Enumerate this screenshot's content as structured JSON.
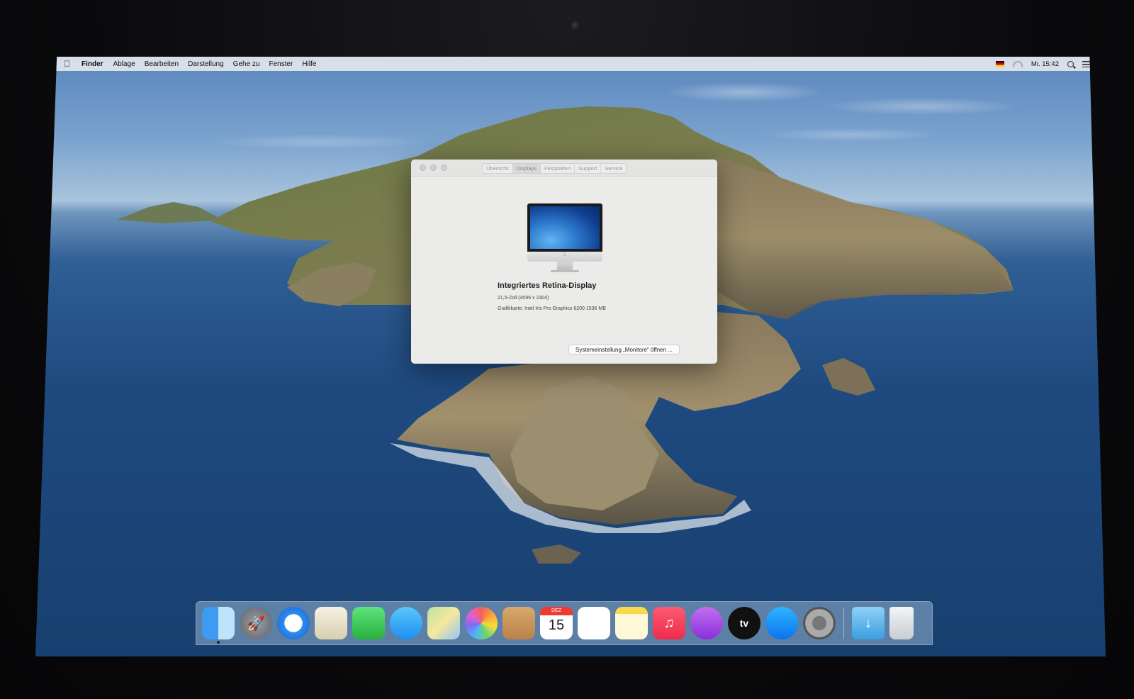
{
  "menubar": {
    "app": "Finder",
    "items": [
      "Ablage",
      "Bearbeiten",
      "Darstellung",
      "Gehe zu",
      "Fenster",
      "Hilfe"
    ],
    "clock": "Mi. 15:42"
  },
  "window": {
    "tabs": [
      "Übersicht",
      "Displays",
      "Festplatten",
      "Support",
      "Service"
    ],
    "active_tab": "Displays",
    "display_name": "Integriertes Retina-Display",
    "display_size": "21,5-Zoll (4096 x 2304)",
    "graphics": "Grafikkarte: Intel Iris Pro Graphics 6200 1536 MB",
    "open_button": "Systemeinstellung „Monitore“ öffnen ..."
  },
  "dock": {
    "calendar_month": "DEZ",
    "calendar_day": "15",
    "tv_label": "tv"
  },
  "colors": {
    "accent": "#2d8df2",
    "menubar": "#e8eaee",
    "window_bg": "#ebebea"
  }
}
